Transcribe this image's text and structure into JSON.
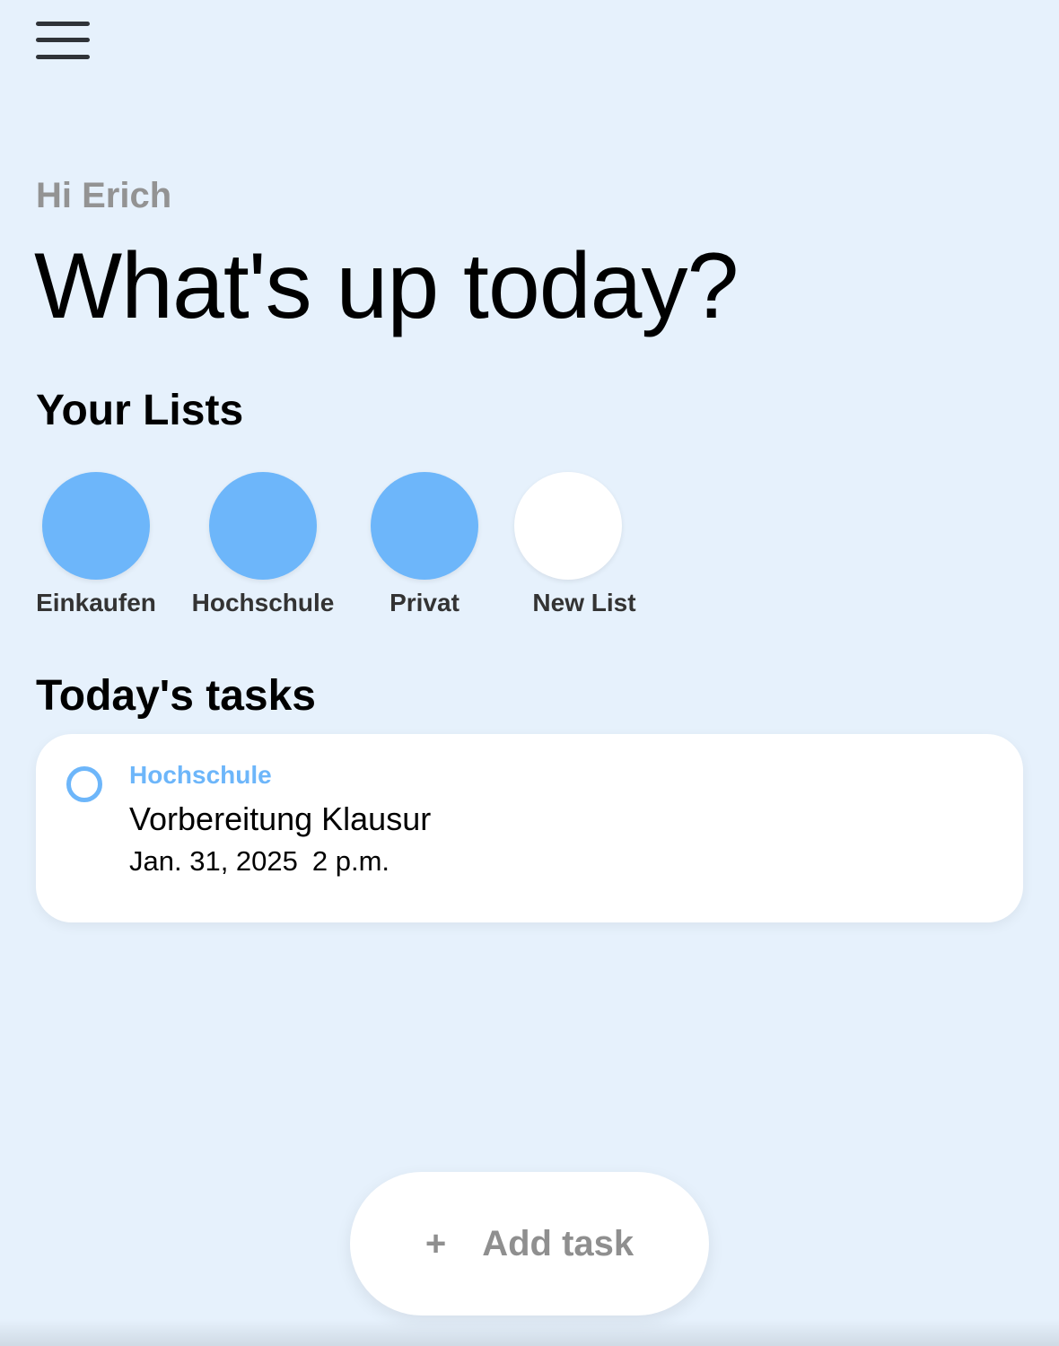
{
  "header": {
    "menu_icon": "hamburger-menu-icon"
  },
  "greeting": "Hi Erich",
  "headline": "What's up today?",
  "lists": {
    "title": "Your Lists",
    "items": [
      {
        "label": "Einkaufen",
        "color": "#6db6fa"
      },
      {
        "label": "Hochschule",
        "color": "#6db6fa"
      },
      {
        "label": "Privat",
        "color": "#6db6fa"
      },
      {
        "label": "New List",
        "color": "#ffffff"
      }
    ]
  },
  "tasks": {
    "title": "Today's tasks",
    "items": [
      {
        "list": "Hochschule",
        "title": "Vorbereitung Klausur",
        "date": "Jan. 31, 2025",
        "time": "2 p.m.",
        "completed": false
      }
    ]
  },
  "add_task": {
    "icon": "+",
    "label": "Add task"
  },
  "colors": {
    "background": "#e6f1fc",
    "accent": "#6db6fa",
    "muted_text": "#939393"
  }
}
